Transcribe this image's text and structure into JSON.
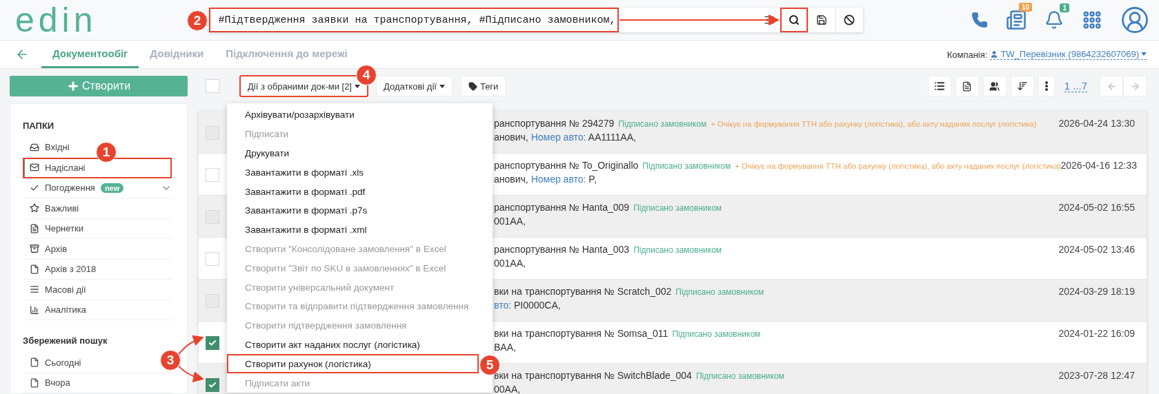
{
  "header": {
    "logo": "edin",
    "search": {
      "value": "#Підтвердження заявки на транспортування, #Підписано замовником,",
      "framed": true,
      "button_framed": true
    },
    "notifications": [
      {
        "count": "10",
        "color": "#f0a04b"
      },
      {
        "count": "1",
        "color": "#4fae8e"
      }
    ]
  },
  "nav": {
    "tabs": [
      {
        "label": "Документообіг",
        "selected": true
      },
      {
        "label": "Довідники",
        "selected": false
      },
      {
        "label": "Підключення до мережі",
        "selected": false
      }
    ],
    "company_label": "Компанія:",
    "company": "TW_Перевізник (9864232607069)"
  },
  "sidebar": {
    "create_button": "Створити",
    "folders_title": "ПАПКИ",
    "folders": [
      {
        "label": "Вхідні",
        "selected": false,
        "expandable": false,
        "framed": false
      },
      {
        "label": "Надіслані",
        "selected": true,
        "expandable": false,
        "framed": true
      },
      {
        "label": "Погодження",
        "selected": false,
        "expandable": true,
        "framed": false,
        "badge": "new"
      },
      {
        "label": "Важливі",
        "selected": false,
        "expandable": false,
        "framed": false
      },
      {
        "label": "Чернетки",
        "selected": false,
        "expandable": false,
        "framed": false
      },
      {
        "label": "Архів",
        "selected": false,
        "expandable": false,
        "framed": false
      },
      {
        "label": "Архів з 2018",
        "selected": false,
        "expandable": false,
        "framed": false
      },
      {
        "label": "Масові дії",
        "selected": false,
        "expandable": false,
        "framed": false
      },
      {
        "label": "Аналітика",
        "selected": false,
        "expandable": false,
        "framed": false
      }
    ],
    "saved_title": "Збережений пошук",
    "saved": [
      {
        "label": "Сьогодні"
      },
      {
        "label": "Вчора"
      }
    ]
  },
  "toolbar": {
    "select_all_checked": false,
    "actions_button": "Дії з обраними док-ми [2]",
    "actions_framed": true,
    "more_button": "Додаткові дії",
    "tags_button": "Теги",
    "pager": "1 ...7"
  },
  "menu": {
    "items": [
      {
        "label": "Архівувати/розархівувати",
        "disabled": false
      },
      {
        "label": "Підписати",
        "disabled": true
      },
      {
        "label": "Друкувати",
        "disabled": false
      },
      {
        "label": "Завантажити в форматі .xls",
        "disabled": false
      },
      {
        "label": "Завантажити в форматі .pdf",
        "disabled": false
      },
      {
        "label": "Завантажити в форматі .p7s",
        "disabled": false
      },
      {
        "label": "Завантажити в форматі .xml",
        "disabled": false
      },
      {
        "label": "Створити \"Консолідоване замовлення\" в Excel",
        "disabled": true
      },
      {
        "label": "Створити \"Звіт по SKU в замовленнях\" в Excel",
        "disabled": true
      },
      {
        "label": "Створити універсальний документ",
        "disabled": true
      },
      {
        "label": "Створити та відправити підтвердження замовлення",
        "disabled": true
      },
      {
        "label": "Створити підтвердження замовлення",
        "disabled": true
      },
      {
        "label": "Створити акт наданих послуг (логістика)",
        "disabled": false
      },
      {
        "label": "Створити рахунок (логістика)",
        "disabled": false,
        "framed": true
      },
      {
        "label": "Підписати акти",
        "disabled": true
      }
    ]
  },
  "documents": [
    {
      "checked": false,
      "title": "ранспортування № 294279",
      "status": "Підписано замовником",
      "note": "+ Очікує на формування ТТН або рахунку (логістика), або акту наданих послуг (логістика)",
      "line2": [
        {
          "kind": "plain",
          "text": "анович, "
        },
        {
          "kind": "label",
          "text": "Номер авто:"
        },
        {
          "kind": "plain",
          "text": " AA1111AA,"
        }
      ],
      "date": "2026-04-24 13:30"
    },
    {
      "checked": false,
      "title": "ранспортування № To_Originallo",
      "status": "Підписано замовником",
      "note": "+ Очікує на формування ТТН або рахунку (логістика), або акту наданих послуг (логістика)",
      "line2": [
        {
          "kind": "plain",
          "text": "анович, "
        },
        {
          "kind": "label",
          "text": "Номер авто:"
        },
        {
          "kind": "plain",
          "text": " P,"
        }
      ],
      "date": "2026-04-16 12:33"
    },
    {
      "checked": false,
      "title": "ранспортування № Hanta_009",
      "status": "Підписано замовником",
      "line2": [
        {
          "kind": "plain",
          "text": "001AA,"
        }
      ],
      "date": "2024-05-02 16:55"
    },
    {
      "checked": false,
      "title": "ранспортування № Hanta_003",
      "status": "Підписано замовником",
      "line2": [
        {
          "kind": "plain",
          "text": "001AA,"
        }
      ],
      "date": "2024-05-02 13:46"
    },
    {
      "checked": false,
      "title": "вки на транспортування № Scratch_002",
      "status": "Підписано замовником",
      "line2": [
        {
          "kind": "label",
          "text": "вто:"
        },
        {
          "kind": "plain",
          "text": " PI0000CA,"
        }
      ],
      "date": "2024-03-29 18:19"
    },
    {
      "checked": true,
      "title": "вки на транспортування № Somsa_011",
      "status": "Підписано замовником",
      "line2": [
        {
          "kind": "plain",
          "text": "BAA,"
        }
      ],
      "date": "2024-01-22 16:09"
    },
    {
      "checked": true,
      "title": "вки на транспортування № SwitchBlade_004",
      "status": "Підписано замовником",
      "line2": [
        {
          "kind": "plain",
          "text": "00AA,"
        }
      ],
      "date": "2023-07-28 12:47"
    }
  ],
  "callouts": [
    "1",
    "2",
    "3",
    "4",
    "5"
  ]
}
